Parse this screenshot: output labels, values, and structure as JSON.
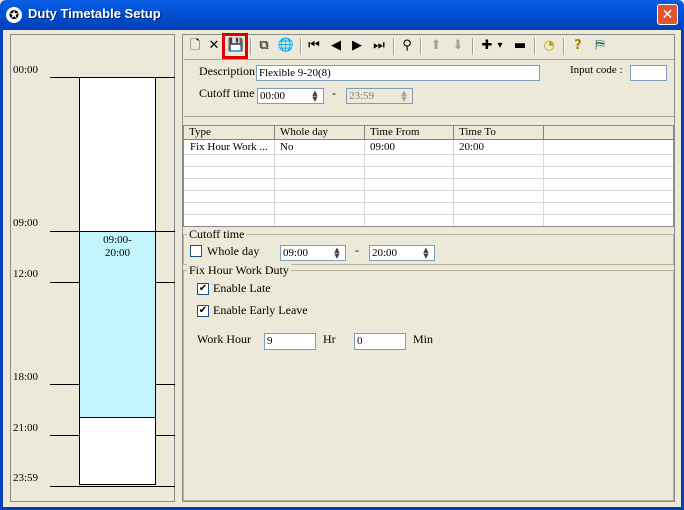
{
  "window": {
    "title": "Duty Timetable Setup"
  },
  "timeline": {
    "labels": [
      "00:00",
      "09:00",
      "12:00",
      "18:00",
      "21:00",
      "23:59"
    ],
    "segment_label": "09:00-\n20:00"
  },
  "toolbar": {
    "new_icon": "🗋",
    "delete_icon": "✕",
    "save_icon": "💾",
    "copy_icon": "⧉",
    "globe_icon": "🌐",
    "first_icon": "⏮",
    "prev_icon": "◀",
    "next_icon": "▶",
    "last_icon": "⏭",
    "find_icon": "⚲",
    "up_icon": "⬆",
    "down_icon": "⬇",
    "add_icon": "✚",
    "dropdown_icon": "▾",
    "remove_icon": "▬",
    "clock_icon": "◔",
    "help_icon": "?",
    "exit_icon": "⛿"
  },
  "form": {
    "description_label": "Description",
    "description_value": "Flexible 9-20(8)",
    "input_code_label": "Input code :",
    "input_code_value": "",
    "cutoff_label": "Cutoff time",
    "cutoff_from": "00:00",
    "cutoff_dash": "-",
    "cutoff_to": "23:59"
  },
  "grid": {
    "headers": [
      "Type",
      "Whole day",
      "Time From",
      "Time To"
    ],
    "rows": [
      [
        "Fix Hour Work ...",
        "No",
        "09:00",
        "20:00"
      ]
    ]
  },
  "cutoff_group": {
    "title": "Cutoff time",
    "whole_day_label": "Whole day",
    "whole_day_checked": false,
    "from": "09:00",
    "dash": "-",
    "to": "20:00"
  },
  "fix_group": {
    "title": "Fix Hour Work Duty",
    "enable_late_label": "Enable Late",
    "enable_late_checked": true,
    "enable_early_label": "Enable Early Leave",
    "enable_early_checked": true,
    "work_hour_label": "Work Hour",
    "hour_value": "9",
    "hr_label": "Hr",
    "min_value": "0",
    "min_label": "Min"
  },
  "colors": {
    "segment": "#c1f5fb",
    "title_bar": "#0052d4",
    "highlight": "#e00000"
  }
}
